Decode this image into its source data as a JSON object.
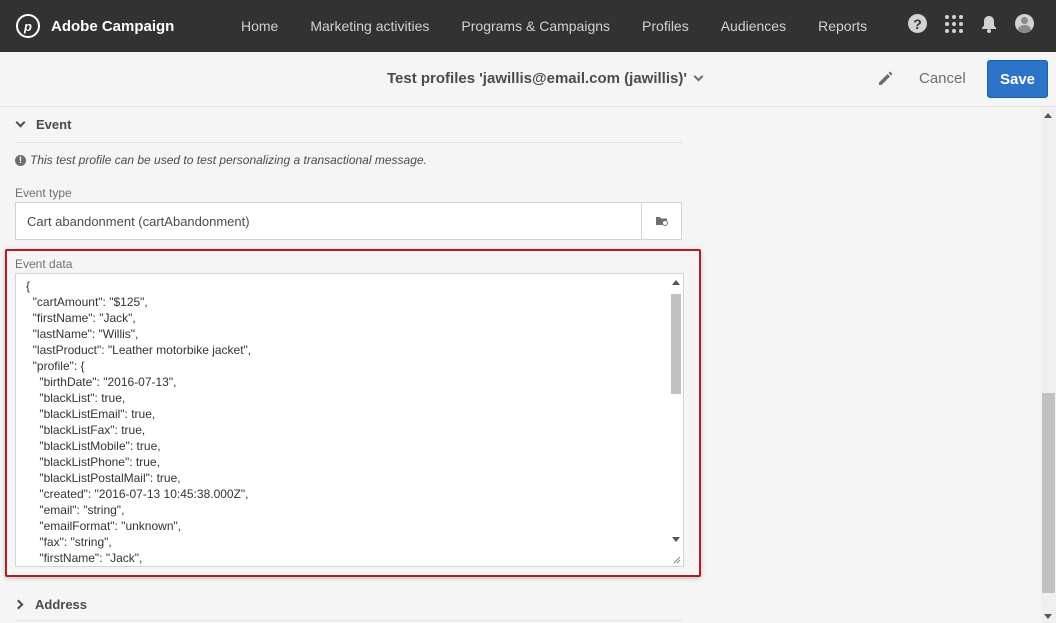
{
  "app": {
    "name": "Adobe Campaign",
    "logo_glyph": "p"
  },
  "nav": {
    "items": [
      {
        "label": "Home"
      },
      {
        "label": "Marketing activities"
      },
      {
        "label": "Programs & Campaigns"
      },
      {
        "label": "Profiles"
      },
      {
        "label": "Audiences"
      },
      {
        "label": "Reports"
      }
    ],
    "help_glyph": "?"
  },
  "header": {
    "title": "Test profiles 'jawillis@email.com (jawillis)'",
    "cancel_label": "Cancel",
    "save_label": "Save"
  },
  "event_section": {
    "title": "Event",
    "info_glyph": "!",
    "info_text": "This test profile can be used to test personalizing a transactional message.",
    "event_type_label": "Event type",
    "event_type_value": "Cart abandonment (cartAbandonment)",
    "event_data_label": "Event data",
    "event_data_lines": [
      "{",
      "  \"cartAmount\": \"$125\",",
      "  \"firstName\": \"Jack\",",
      "  \"lastName\": \"Willis\",",
      "  \"lastProduct\": \"Leather motorbike jacket\",",
      "  \"profile\": {",
      "    \"birthDate\": \"2016-07-13\",",
      "    \"blackList\": true,",
      "    \"blackListEmail\": true,",
      "    \"blackListFax\": true,",
      "    \"blackListMobile\": true,",
      "    \"blackListPhone\": true,",
      "    \"blackListPostalMail\": true,",
      "    \"created\": \"2016-07-13 10:45:38.000Z\",",
      "    \"email\": \"string\",",
      "    \"emailFormat\": \"unknown\",",
      "    \"fax\": \"string\",",
      "    \"firstName\": \"Jack\","
    ]
  },
  "address_section": {
    "title": "Address"
  },
  "colors": {
    "nav_bg": "#323232",
    "accent": "#2d73c8",
    "highlight": "#b01e23",
    "page_bg": "#f5f5f5"
  }
}
